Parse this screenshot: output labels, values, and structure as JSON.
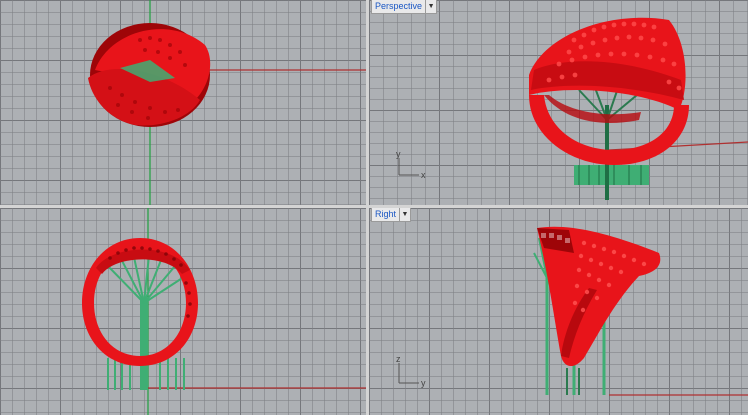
{
  "viewports": {
    "top": {
      "label": ""
    },
    "perspective": {
      "label": "Perspective",
      "dropdown_icon": "chevron-down-icon"
    },
    "front": {
      "label": ""
    },
    "right": {
      "label": "Right",
      "dropdown_icon": "chevron-down-icon"
    }
  },
  "axes": {
    "perspective": {
      "vertical": "y",
      "horizontal": "x"
    },
    "right": {
      "vertical": "z",
      "horizontal": "y"
    }
  },
  "colors": {
    "model": "#e8141a",
    "model_dark": "#9e0508",
    "support": "#3fae74",
    "support_dark": "#1f6e45",
    "grid_bg": "#adb0b4",
    "x_axis": "#b03030",
    "y_axis": "#2aa048",
    "label_text": "#1a57c4"
  }
}
